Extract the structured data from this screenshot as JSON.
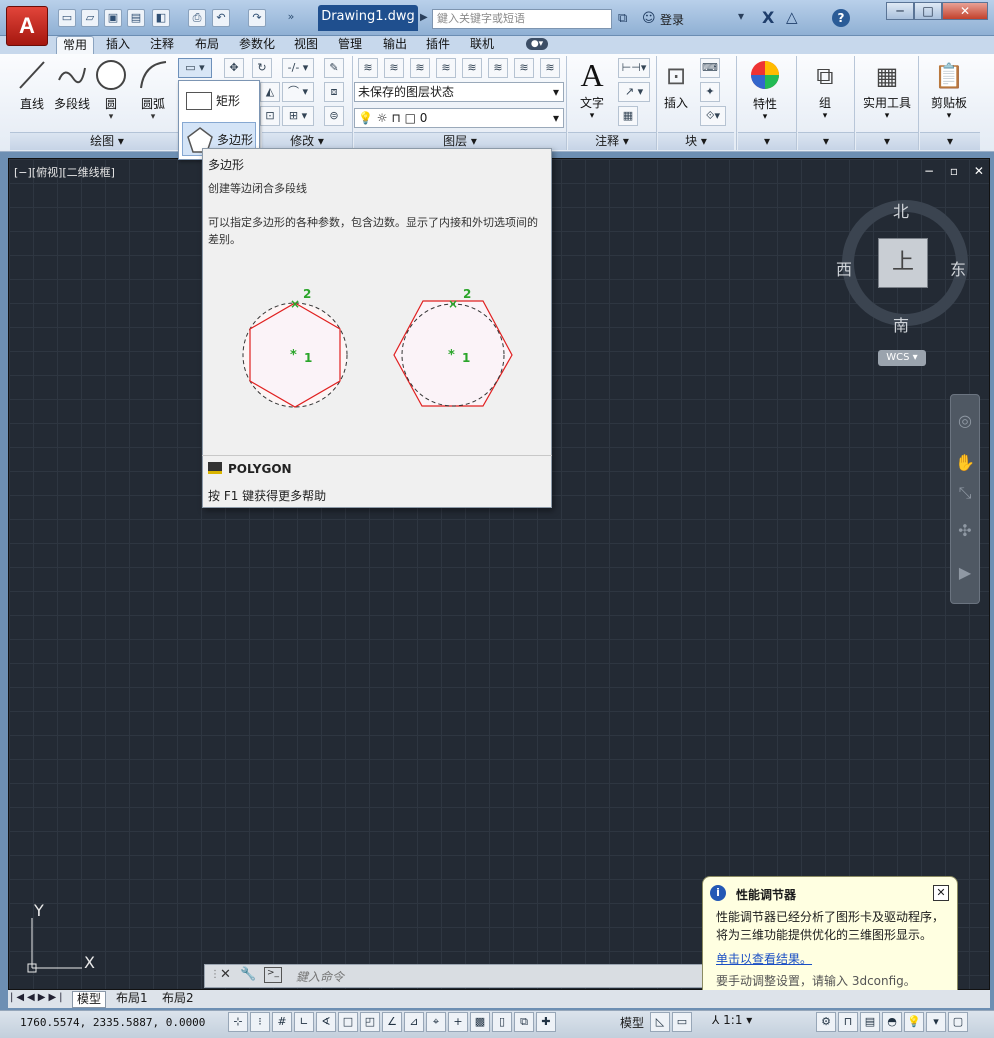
{
  "app": {
    "logo": "A",
    "document_title": "Drawing1.dwg",
    "search_placeholder": "鍵入关键字或短语",
    "login_label": "登录",
    "help_label": "?"
  },
  "window": {
    "min": "─",
    "max": "□",
    "close": "✕"
  },
  "tabs": [
    "常用",
    "插入",
    "注释",
    "布局",
    "参数化",
    "视图",
    "管理",
    "输出",
    "插件",
    "联机"
  ],
  "ribbon": {
    "draw": {
      "line": "直线",
      "polyline": "多段线",
      "circle": "圆",
      "arc": "圆弧",
      "panel": "绘图 ▾"
    },
    "modify": {
      "panel": "修改 ▾"
    },
    "layers": {
      "state": "未保存的图层状态",
      "current": "0",
      "panel": "图层 ▾"
    },
    "annotation": {
      "text": "文字",
      "panel": "注释 ▾"
    },
    "block": {
      "insert": "插入",
      "panel": "块 ▾"
    },
    "props": {
      "label": "特性"
    },
    "groups": {
      "label": "组"
    },
    "utilities": {
      "label": "实用工具"
    },
    "clipboard": {
      "label": "剪贴板"
    }
  },
  "dropdown": {
    "rect": "矩形",
    "polygon": "多边形"
  },
  "tooltip": {
    "title": "多边形",
    "subtitle": "创建等边闭合多段线",
    "description": "可以指定多边形的各种参数，包含边数。显示了内接和外切选项间的差别。",
    "point1": "1",
    "point2": "2",
    "command": "POLYGON",
    "help": "按 F1 键获得更多帮助"
  },
  "viewport": {
    "label": "[−][俯视][二维线框]",
    "controls": "− ▫ ✕"
  },
  "viewcube": {
    "north": "北",
    "south": "南",
    "east": "东",
    "west": "西",
    "face": "上",
    "wcs": "WCS ▾"
  },
  "ucs": {
    "y": "Y",
    "x": "X"
  },
  "command": {
    "placeholder": "鍵入命令"
  },
  "balloon": {
    "title": "性能调节器",
    "body": "性能调节器已经分析了图形卡及驱动程序，将为三维功能提供优化的三维图形显示。",
    "link": "单击以查看结果。",
    "footer": "要手动调整设置，请输入 3dconfig。",
    "close": "✕"
  },
  "layout_tabs": [
    "模型",
    "布局1",
    "布局2"
  ],
  "status": {
    "coords": "1760.5574, 2335.5887, 0.0000",
    "model": "模型",
    "scale": "1:1"
  },
  "colors": {
    "viewport_bg": "#232a34",
    "polygon_red": "#e02020",
    "marker_green": "#2aa52a"
  }
}
